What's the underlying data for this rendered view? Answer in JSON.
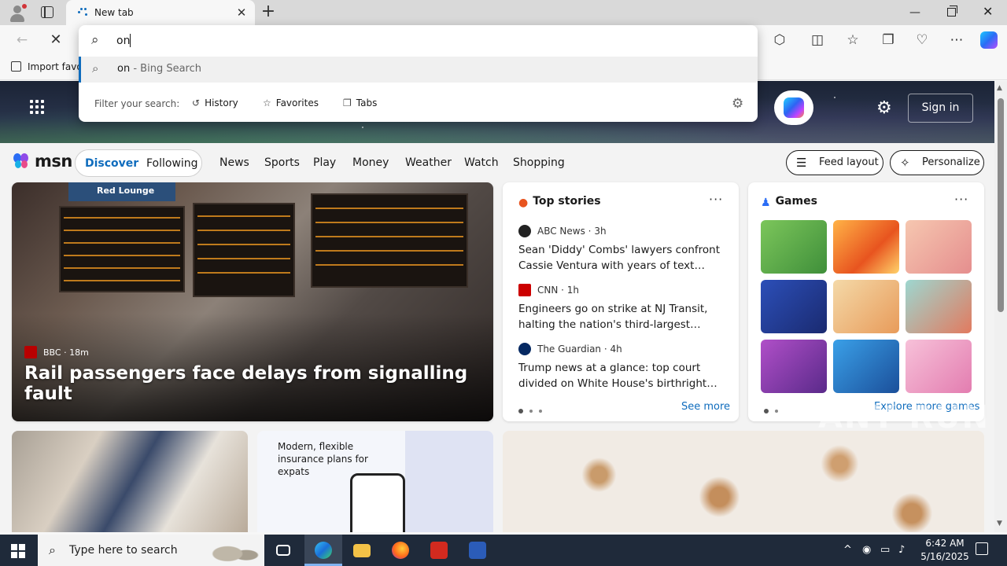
{
  "browser": {
    "tab": {
      "title": "New tab",
      "close_icon": "close-icon"
    },
    "newtab_icon": "plus-icon",
    "window_controls": [
      "minimize-icon",
      "restore-icon",
      "close-icon"
    ],
    "favorites_bar": {
      "import_label": "Import favo"
    }
  },
  "omnibox": {
    "value": "on",
    "suggestion": {
      "query": "on",
      "separator": " - ",
      "engine": "Bing Search"
    },
    "filter_label": "Filter your search:",
    "filters": [
      {
        "label": "History",
        "icon": "history-icon"
      },
      {
        "label": "Favorites",
        "icon": "star-icon"
      },
      {
        "label": "Tabs",
        "icon": "tabs-icon"
      }
    ]
  },
  "hero": {
    "signin_label": "Sign in"
  },
  "msn": {
    "logo_text": "msn",
    "segments": [
      "Discover",
      "Following"
    ],
    "nav": [
      "News",
      "Sports",
      "Play",
      "Money",
      "Weather",
      "Watch",
      "Shopping"
    ],
    "feed_layout_label": "Feed layout",
    "personalize_label": "Personalize",
    "main_story": {
      "sign": "Red Lounge",
      "source": "BBC",
      "age": "18m",
      "title": "Rail passengers face delays from signalling fault"
    },
    "top_stories": {
      "heading": "Top stories",
      "items": [
        {
          "source": "ABC News",
          "age": "3h",
          "title": "Sean 'Diddy' Combs' lawyers confront Cassie Ventura with years of text…"
        },
        {
          "source": "CNN",
          "age": "1h",
          "title": "Engineers go on strike at NJ Transit, halting the nation's third-largest…"
        },
        {
          "source": "The Guardian",
          "age": "4h",
          "title": "Trump news at a glance: top court divided on White House's birthright…"
        }
      ],
      "see_more": "See more"
    },
    "games": {
      "heading": "Games",
      "explore": "Explore more games"
    },
    "ad": {
      "text": "Modern, flexible insurance plans for expats"
    },
    "watermark": "ANY RUN"
  },
  "taskbar": {
    "search_placeholder": "Type here to search",
    "time": "6:42 AM",
    "date": "5/16/2025"
  },
  "colors": {
    "accent": "#0f6cbd",
    "taskbar": "#1f2a3a"
  }
}
